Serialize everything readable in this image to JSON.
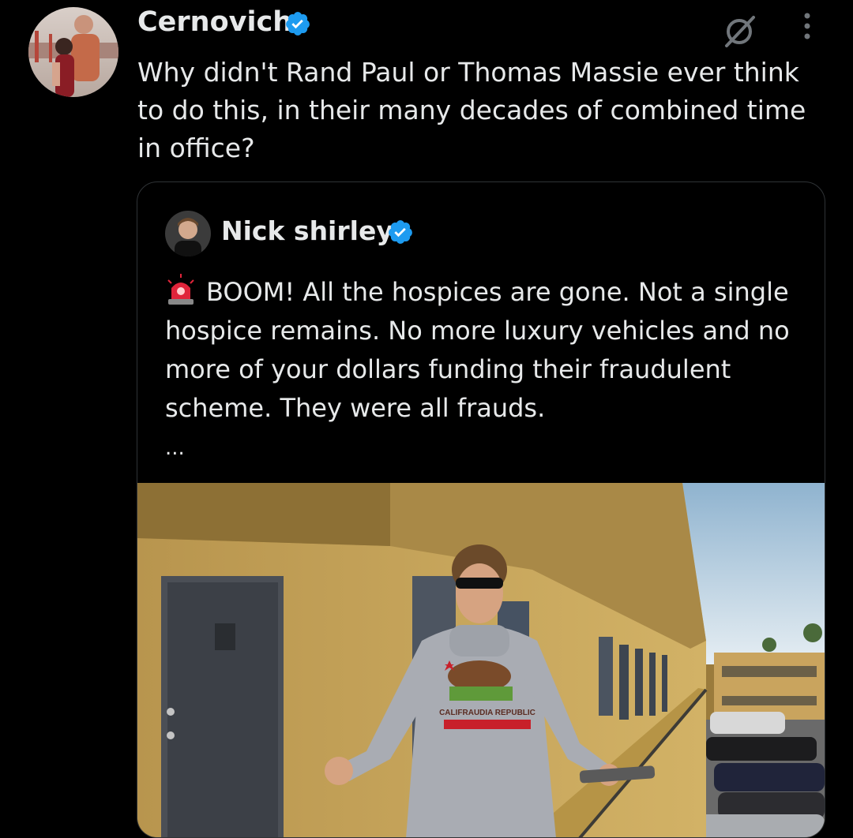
{
  "tweet": {
    "author_name": "Cernovich",
    "text": "Why didn't Rand Paul or Thomas Massie ever think to do this, in their many decades of combined time in office?"
  },
  "quoted_tweet": {
    "author_name": "Nick shirley",
    "text": "BOOM! All the hospices are gone. Not a single hospice remains. No more luxury vehicles and no more of your dollars funding their fraudulent scheme. They were all frauds.",
    "more": "...",
    "emoji": "rotating-light-icon",
    "media_sweatshirt_text": "CALIFRAUDIA REPUBLIC"
  },
  "icons": {
    "grok": "grok-icon",
    "more": "more-vertical-icon",
    "verified": "verified-badge-icon"
  },
  "colors": {
    "verified": "#1d9bf0",
    "background": "#000000",
    "text": "#e7e9ea",
    "border": "#2f3336"
  }
}
